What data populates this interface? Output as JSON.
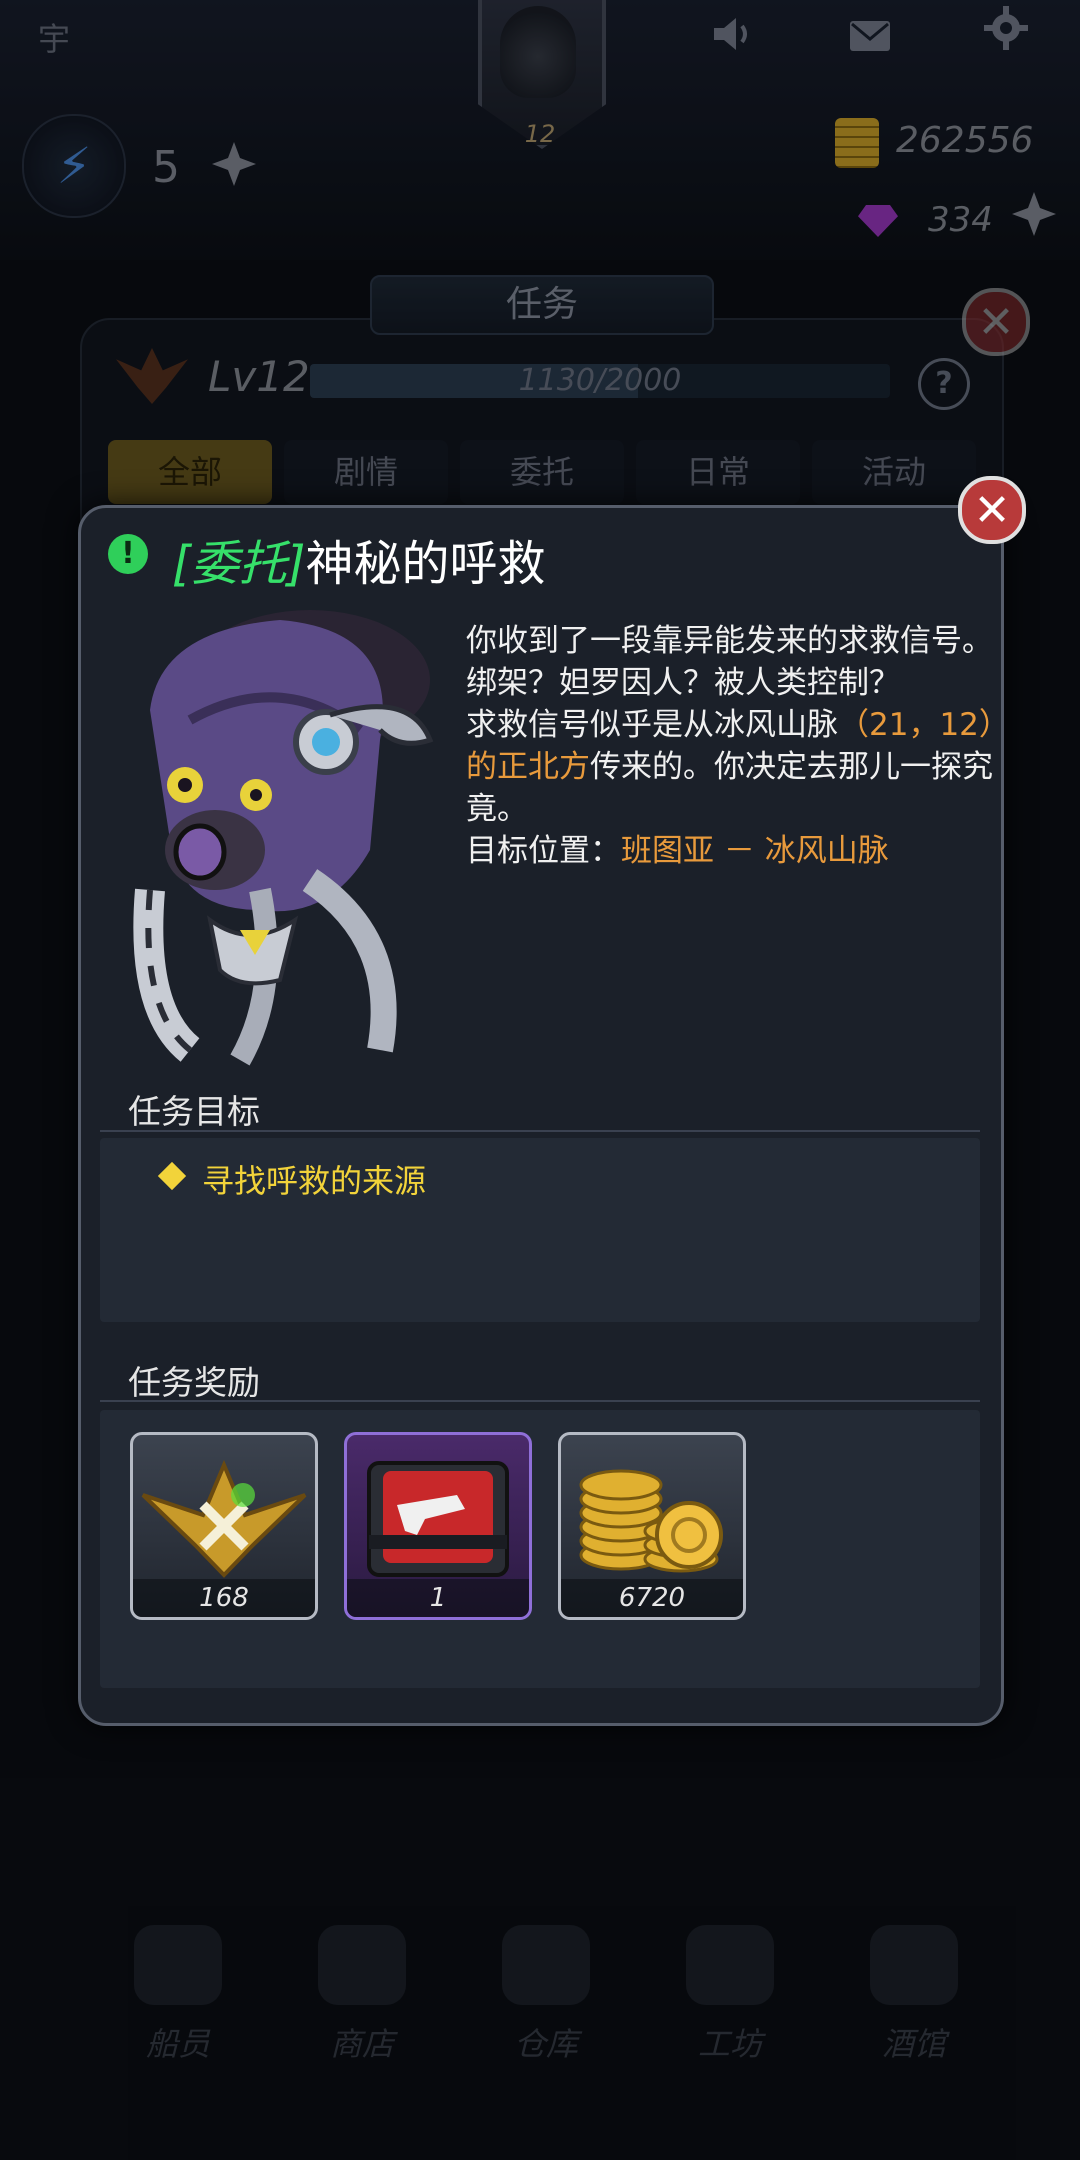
{
  "hud": {
    "corner_char": "宇",
    "energy": "5",
    "player_level": "12",
    "coins": "262556",
    "gems": "334",
    "icons": [
      "speaker-icon",
      "mail-icon",
      "gear-icon"
    ]
  },
  "quest_panel": {
    "title": "任务",
    "level_label": "Lv12",
    "xp_text": "1130/2000",
    "xp_progress": 0.565,
    "help": "?",
    "tabs": [
      "全部",
      "剧情",
      "委托",
      "日常",
      "活动"
    ],
    "active_tab": "全部"
  },
  "dialog": {
    "tag": "[委托]",
    "title": "神秘的呼救",
    "desc_p1": "你收到了一段靠异能发来的求救信号。",
    "desc_p2": "绑架？妲罗因人？被人类控制？",
    "desc_p3a": "求救信号似乎是从冰风山脉",
    "desc_p3b": "（21，12）的正北方",
    "desc_p3c": "传来的。你决定去那儿一探究竟。",
    "target_label": "目标位置：",
    "target_value": "班图亚 － 冰风山脉",
    "objective_heading": "任务目标",
    "objective": "寻找呼救的来源",
    "reward_heading": "任务奖励",
    "rewards": [
      {
        "icon": "xp-emblem-icon",
        "count": "168"
      },
      {
        "icon": "weapon-crate-icon",
        "count": "1"
      },
      {
        "icon": "gold-coins-icon",
        "count": "6720"
      }
    ],
    "close": "✕"
  },
  "nav": [
    "船员",
    "商店",
    "仓库",
    "工坊",
    "酒馆"
  ],
  "colors": {
    "accent_green": "#36e06a",
    "highlight_orange": "#e89a3c",
    "objective_yellow": "#f2d33a",
    "close_red": "#b83a3a"
  }
}
